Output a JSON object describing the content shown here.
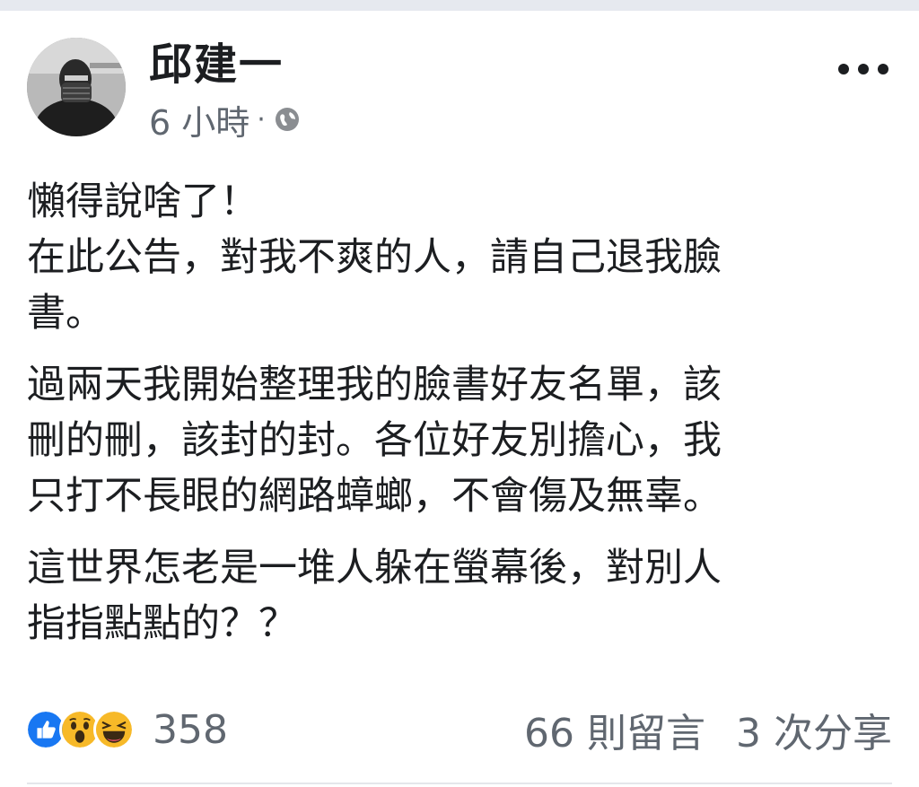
{
  "post": {
    "author": "邱建一",
    "time": "6 小時",
    "separator": "·",
    "privacy_icon": "globe-icon",
    "more_icon": "more-horizontal-icon",
    "paragraphs": [
      "懶得說啥了！\n在此公告，對我不爽的人，請自己退我臉\n書。",
      "過兩天我開始整理我的臉書好友名單，該\n刪的刪，該封的封。各位好友別擔心，我\n只打不長眼的網路蟑螂，不會傷及無辜。",
      "這世界怎老是一堆人躲在螢幕後，對別人\n指指點點的？？"
    ]
  },
  "footer": {
    "reaction_icons": [
      "like-icon",
      "wow-icon",
      "haha-icon"
    ],
    "reaction_count": "358",
    "comments": "66 則留言",
    "shares": "3 次分享"
  },
  "colors": {
    "text": "#1c1e21",
    "secondary": "#606770",
    "like_blue": "#1877f2",
    "emoji_yellow": "#f7b928"
  }
}
